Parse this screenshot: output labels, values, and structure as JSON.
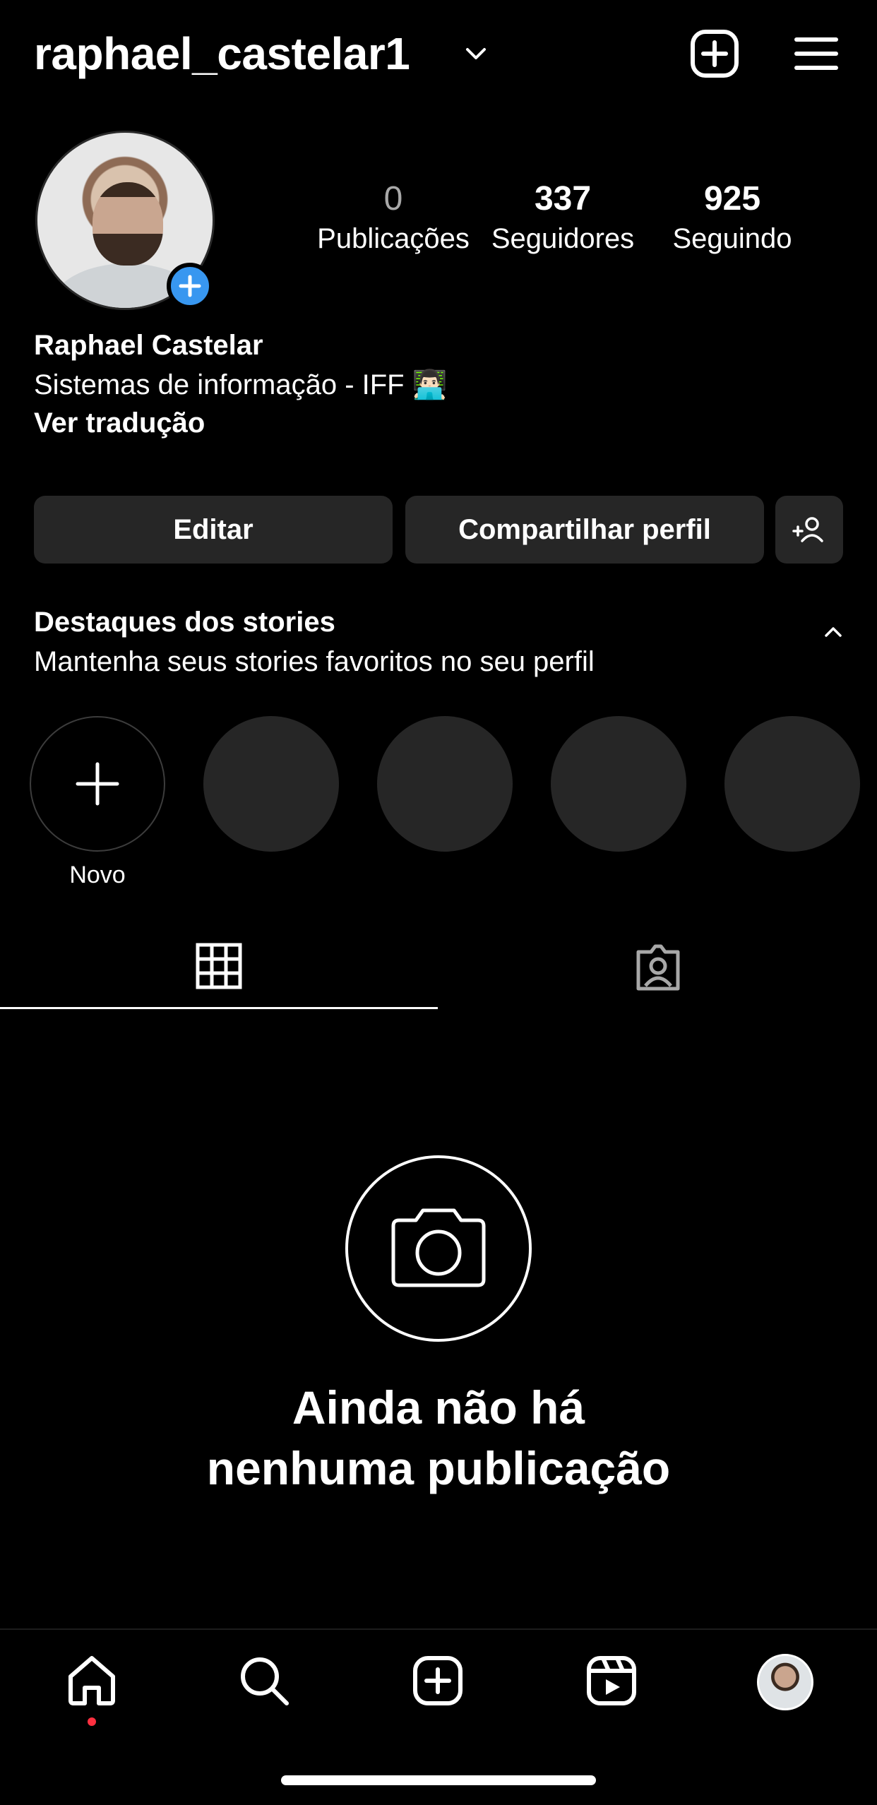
{
  "header": {
    "username": "raphael_castelar1",
    "icons": [
      "chevron-down-icon",
      "new-post-icon",
      "menu-icon"
    ]
  },
  "profile": {
    "stats": [
      {
        "value": "0",
        "label": "Publicações"
      },
      {
        "value": "337",
        "label": "Seguidores"
      },
      {
        "value": "925",
        "label": "Seguindo"
      }
    ],
    "full_name": "Raphael Castelar",
    "bio": "Sistemas de informação - IFF 👨🏻‍💻",
    "see_translation": "Ver tradução"
  },
  "buttons": {
    "edit": "Editar",
    "share": "Compartilhar perfil",
    "discover_people_icon": "add-person-icon"
  },
  "highlights": {
    "title": "Destaques dos stories",
    "subtitle": "Mantenha seus stories favoritos no seu perfil",
    "new_label": "Novo",
    "placeholder_count": 4
  },
  "tabs": [
    "grid-icon",
    "tagged-icon"
  ],
  "empty_state": {
    "line1": "Ainda não há",
    "line2": "nenhuma publicação"
  },
  "bottom_nav": [
    "home-icon",
    "search-icon",
    "create-icon",
    "reels-icon",
    "profile-avatar"
  ],
  "colors": {
    "background": "#000000",
    "button_bg": "#262626",
    "accent_blue": "#3897f0",
    "notification_red": "#ff3040"
  }
}
